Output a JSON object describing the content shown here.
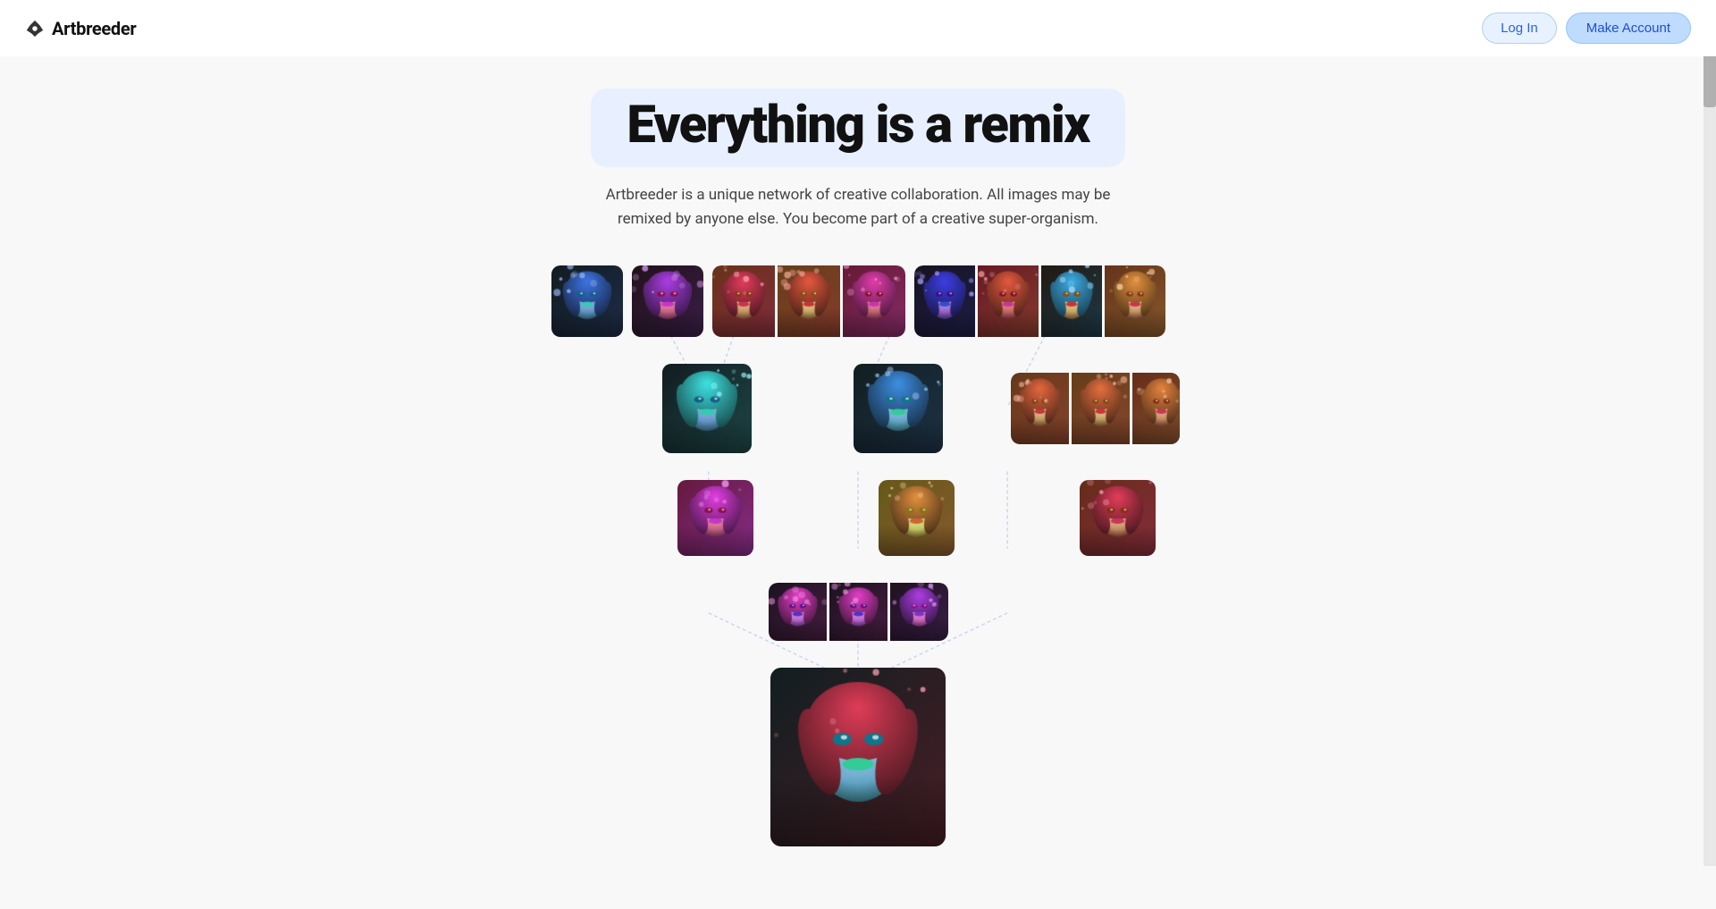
{
  "header": {
    "logo_text": "Artbreeder",
    "login_label": "Log In",
    "make_account_label": "Make Account"
  },
  "hero": {
    "title": "Everything is a remix",
    "subtitle": "Artbreeder is a unique network of creative collaboration. All images may be remixed by anyone else. You become part of a creative super-organism."
  },
  "tree": {
    "description": "Visual remix tree showing parent-child image relationships"
  }
}
